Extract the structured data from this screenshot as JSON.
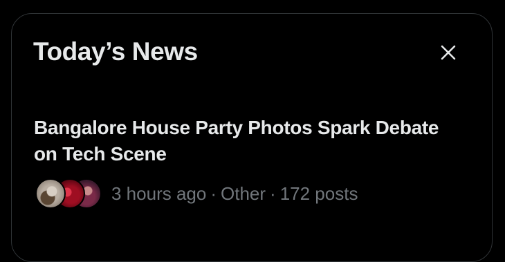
{
  "panel": {
    "title": "Today’s News",
    "close_icon": "close-icon"
  },
  "story": {
    "headline": "Bangalore House Party Photos Spark Debate on Tech Scene",
    "time": "3 hours ago",
    "separator": "·",
    "category": "Other",
    "posts": "172 posts"
  },
  "colors": {
    "background": "#000000",
    "primary_text": "#e7e9ea",
    "secondary_text": "#71767b",
    "border": "#2f3336"
  }
}
